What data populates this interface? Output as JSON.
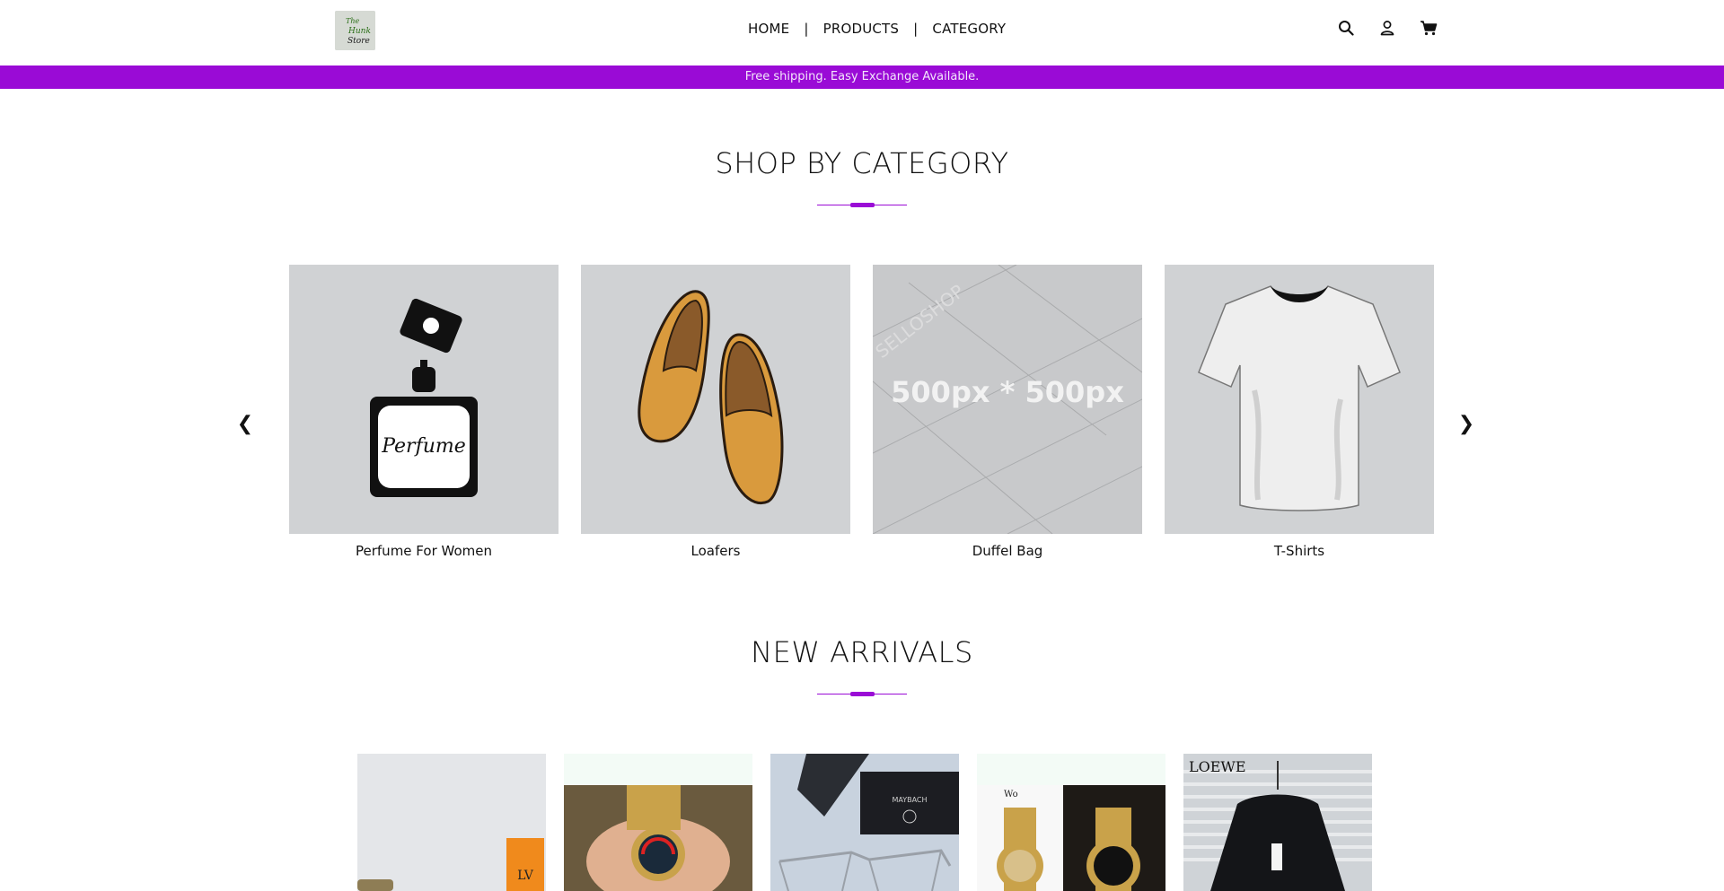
{
  "logo": {
    "alt": "The Hunk Store",
    "text_lines": [
      "The",
      "Hunk",
      "Store"
    ]
  },
  "nav": {
    "items": [
      "HOME",
      "PRODUCTS",
      "CATEGORY"
    ],
    "separator": "|"
  },
  "header_icons": [
    "search-icon",
    "user-icon",
    "cart-icon"
  ],
  "promo_text": "Free shipping. Easy Exchange Available.",
  "categories_section": {
    "title": "SHOP BY CATEGORY",
    "prev_arrow": "❮",
    "next_arrow": "❯",
    "items": [
      {
        "label": "Perfume For Women",
        "image_text": "Perfume"
      },
      {
        "label": "Loafers"
      },
      {
        "label": "Duffel Bag",
        "image_text": "500px * 500px",
        "watermark": "SELLOSHOP"
      },
      {
        "label": "T-Shirts"
      }
    ]
  },
  "arrivals_section": {
    "title": "NEW ARRIVALS",
    "items": [
      {
        "image": "louis-vuitton-box"
      },
      {
        "image": "gold-watch-in-hand"
      },
      {
        "image": "maybach-eyeglasses",
        "image_text": "MAYBACH"
      },
      {
        "image": "gold-chronograph-watches",
        "image_text": "Wo"
      },
      {
        "image": "loewe-black-shirt",
        "image_text": "LOEWE"
      }
    ]
  },
  "colors": {
    "accent": "#9a0bd6",
    "card_bg": "#d0d2d4"
  }
}
